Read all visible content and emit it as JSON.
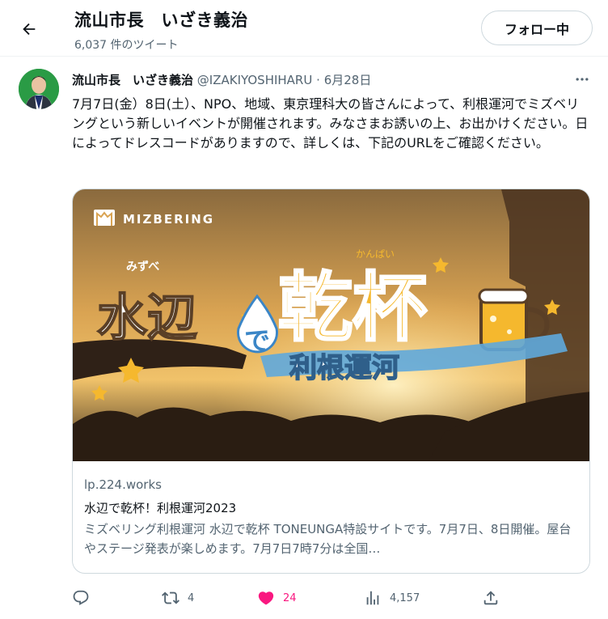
{
  "header": {
    "title": "流山市長　いざき義治",
    "tweet_count": "6,037 件のツイート",
    "follow_label": "フォロー中"
  },
  "tweet": {
    "author_name": "流山市長　いざき義治",
    "handle": "@IZAKIYOSHIHARU",
    "separator": "·",
    "date": "6月28日",
    "text": "7月7日(金）8日(土）、NPO、地域、東京理科大の皆さんによって、利根運河でミズベリングという新しいイベントが開催されます。みなさまお誘いの上、お出かけください。日によってドレスコードがありますので、詳しくは、下記のURLをご確認ください。"
  },
  "card": {
    "image": {
      "brand": "MIZBERING",
      "furigana_mizube": "みずべ",
      "word_mizube": "水辺",
      "word_de": "で",
      "furigana_kanpai": "かんぱい",
      "word_kanpai": "乾杯",
      "word_tone": "利根運河"
    },
    "domain": "lp.224.works",
    "title": "水辺で乾杯！利根運河2023",
    "description": "ミズベリング利根運河 水辺で乾杯 TONEUNGA特設サイトです。7月7日、8日開催。屋台やステージ発表が楽しめます。7月7日7時7分は全国…"
  },
  "actions": {
    "reply_count": "",
    "retweet_count": "4",
    "like_count": "24",
    "view_count": "4,157"
  },
  "colors": {
    "like": "#f91880",
    "muted": "#536471",
    "border": "#cfd9de"
  },
  "icons": [
    "back-arrow-icon",
    "more-icon",
    "reply-icon",
    "retweet-icon",
    "heart-icon",
    "views-icon",
    "share-icon"
  ]
}
